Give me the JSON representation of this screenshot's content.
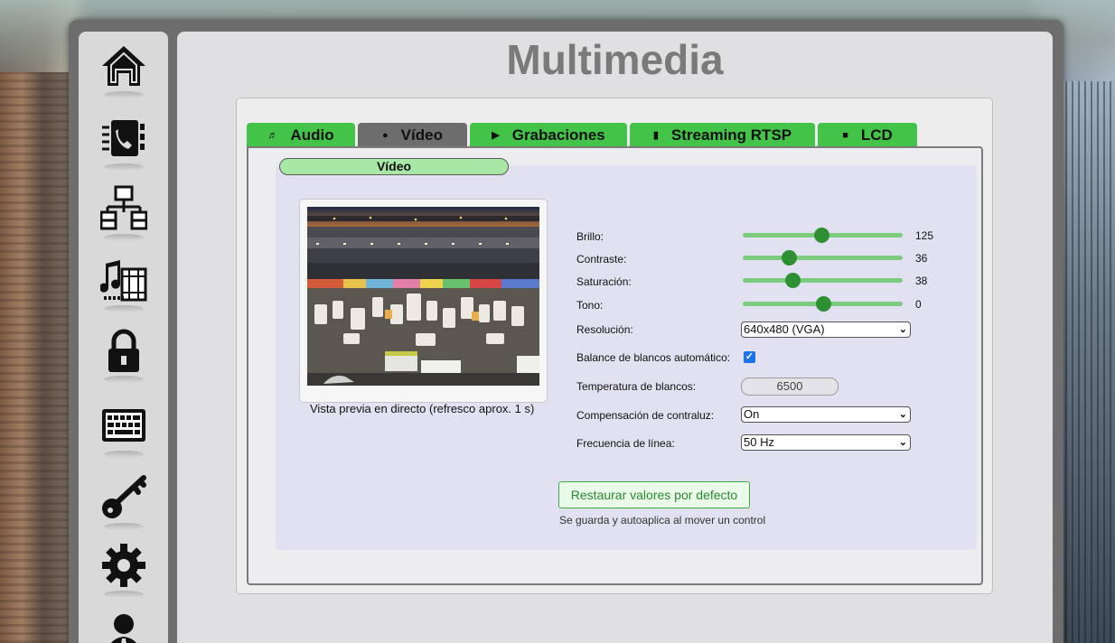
{
  "page": {
    "title": "Multimedia"
  },
  "sidebar": {
    "items": [
      {
        "name": "home",
        "icon": "home-icon"
      },
      {
        "name": "phonebook",
        "icon": "phonebook-icon"
      },
      {
        "name": "network",
        "icon": "network-icon"
      },
      {
        "name": "multimedia",
        "icon": "multimedia-icon"
      },
      {
        "name": "security",
        "icon": "lock-icon"
      },
      {
        "name": "keyboard",
        "icon": "keyboard-icon"
      },
      {
        "name": "access",
        "icon": "key-icon"
      },
      {
        "name": "settings",
        "icon": "gear-icon"
      },
      {
        "name": "users",
        "icon": "user-icon"
      }
    ]
  },
  "tabs": [
    {
      "label": "Audio",
      "icon": "♬",
      "active": false
    },
    {
      "label": "Vídeo",
      "icon": "●",
      "active": true
    },
    {
      "label": "Grabaciones",
      "icon": "▶",
      "active": false
    },
    {
      "label": "Streaming RTSP",
      "icon": "▮",
      "active": false
    },
    {
      "label": "LCD",
      "icon": "■",
      "active": false
    }
  ],
  "video": {
    "section_title": "Vídeo",
    "preview_caption": "Vista previa en directo (refresco aprox. 1 s)",
    "brightness": {
      "label": "Brillo:",
      "value": "125",
      "fraction": 0.49
    },
    "contrast": {
      "label": "Contraste:",
      "value": "36",
      "fraction": 0.29
    },
    "saturation": {
      "label": "Saturación:",
      "value": "38",
      "fraction": 0.31
    },
    "hue": {
      "label": "Tono:",
      "value": "0",
      "fraction": 0.5
    },
    "resolution": {
      "label": "Resolución:",
      "value": "640x480 (VGA)"
    },
    "auto_wb": {
      "label": "Balance de blancos automático:",
      "checked": true
    },
    "wb_temp": {
      "label": "Temperatura de blancos:",
      "value": "6500"
    },
    "backlight": {
      "label": "Compensación de contraluz:",
      "value": "On"
    },
    "line_freq": {
      "label": "Frecuencia de línea:",
      "value": "50 Hz"
    },
    "restore_label": "Restaurar valores por defecto",
    "hint": "Se guarda y autoaplica al mover un control"
  },
  "colors": {
    "accent_green": "#43c348",
    "active_tab": "#6d6d6d",
    "thumb": "#2e8f33"
  }
}
